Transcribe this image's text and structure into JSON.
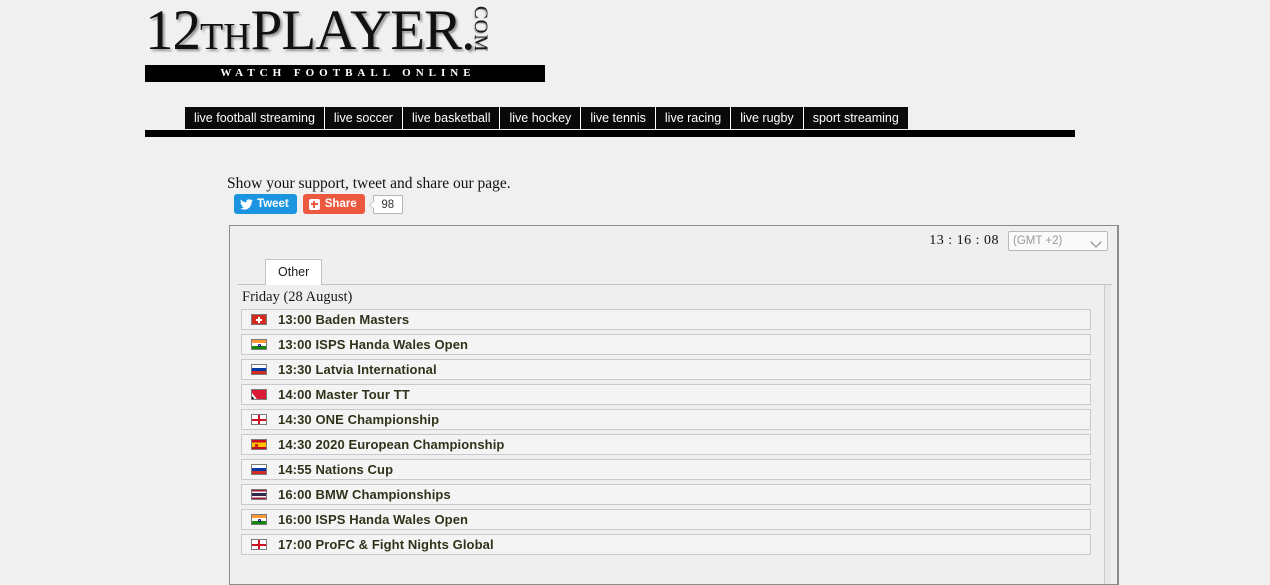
{
  "site": {
    "logo_main": "12",
    "logo_th": "TH",
    "logo_player": "PLAYER.",
    "logo_dotcom": "COM",
    "logo_tagline": "WATCH FOOTBALL ONLINE"
  },
  "nav": {
    "items": [
      {
        "label": "live football streaming"
      },
      {
        "label": "live soccer"
      },
      {
        "label": "live basketball"
      },
      {
        "label": "live hockey"
      },
      {
        "label": "live tennis"
      },
      {
        "label": "live racing"
      },
      {
        "label": "live rugby"
      },
      {
        "label": "sport streaming"
      }
    ]
  },
  "share": {
    "prompt": "Show your support, tweet and share our page.",
    "tweet_label": "Tweet",
    "share_label": "Share",
    "count": "98",
    "tweet_color": "#1b95e0",
    "share_color": "#ec5840"
  },
  "panel": {
    "clock": "13 : 16 : 08",
    "timezone": "(GMT +2)",
    "tab": "Other",
    "day_header": "Friday (28 August)",
    "events": [
      {
        "time": "13:00",
        "name": "Baden Masters",
        "flag": "switzerland",
        "flag_class": "f-ch"
      },
      {
        "time": "13:00",
        "name": "ISPS Handa Wales Open",
        "flag": "india",
        "flag_class": "f-in"
      },
      {
        "time": "13:30",
        "name": "Latvia International",
        "flag": "russia",
        "flag_class": "f-ru"
      },
      {
        "time": "14:00",
        "name": "Master Tour TT",
        "flag": "trinidad-and-tobago",
        "flag_class": "f-tt"
      },
      {
        "time": "14:30",
        "name": "ONE Championship",
        "flag": "england",
        "flag_class": "f-en"
      },
      {
        "time": "14:30",
        "name": "2020 European Championship",
        "flag": "spain",
        "flag_class": "f-es"
      },
      {
        "time": "14:55",
        "name": "Nations Cup",
        "flag": "russia",
        "flag_class": "f-ru"
      },
      {
        "time": "16:00",
        "name": "BMW Championships",
        "flag": "thailand",
        "flag_class": "f-th"
      },
      {
        "time": "16:00",
        "name": "ISPS Handa Wales Open",
        "flag": "india",
        "flag_class": "f-in"
      },
      {
        "time": "17:00",
        "name": "ProFC & Fight Nights Global",
        "flag": "england",
        "flag_class": "f-en"
      }
    ]
  }
}
